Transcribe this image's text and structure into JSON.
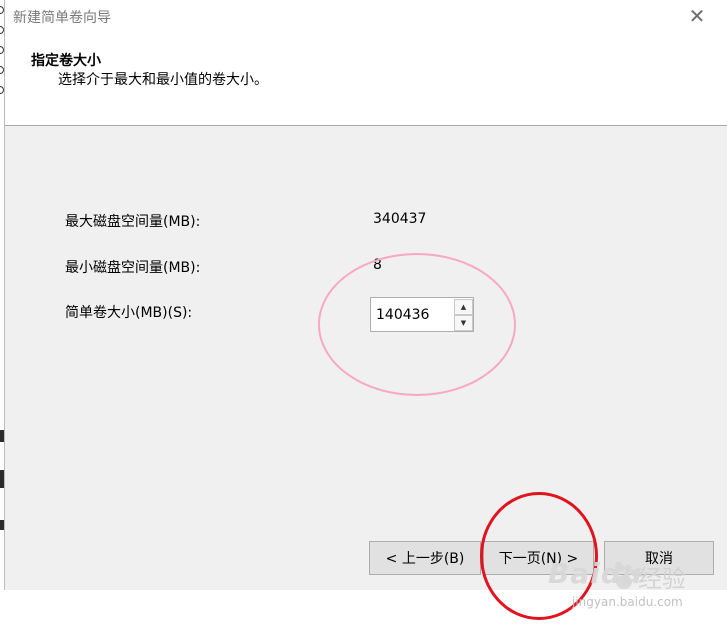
{
  "window": {
    "title": "新建简单卷向导",
    "close_glyph": "✕"
  },
  "header": {
    "title": "指定卷大小",
    "subtitle": "选择介于最大和最小值的卷大小。"
  },
  "fields": {
    "max_label": "最大磁盘空间量(MB):",
    "max_value": "340437",
    "min_label": "最小磁盘空间量(MB):",
    "min_value": "8",
    "size_label": "简单卷大小(MB)(S):",
    "size_value": "140436"
  },
  "buttons": {
    "back": "< 上一步(B)",
    "next": "下一页(N) >",
    "cancel": "取消"
  },
  "watermark": {
    "logo": "Baidu",
    "text": "经验",
    "url": "jingyan.baidu.com"
  },
  "colors": {
    "pink_annotation": "#f8a7c4",
    "red_annotation": "#e1141e"
  }
}
